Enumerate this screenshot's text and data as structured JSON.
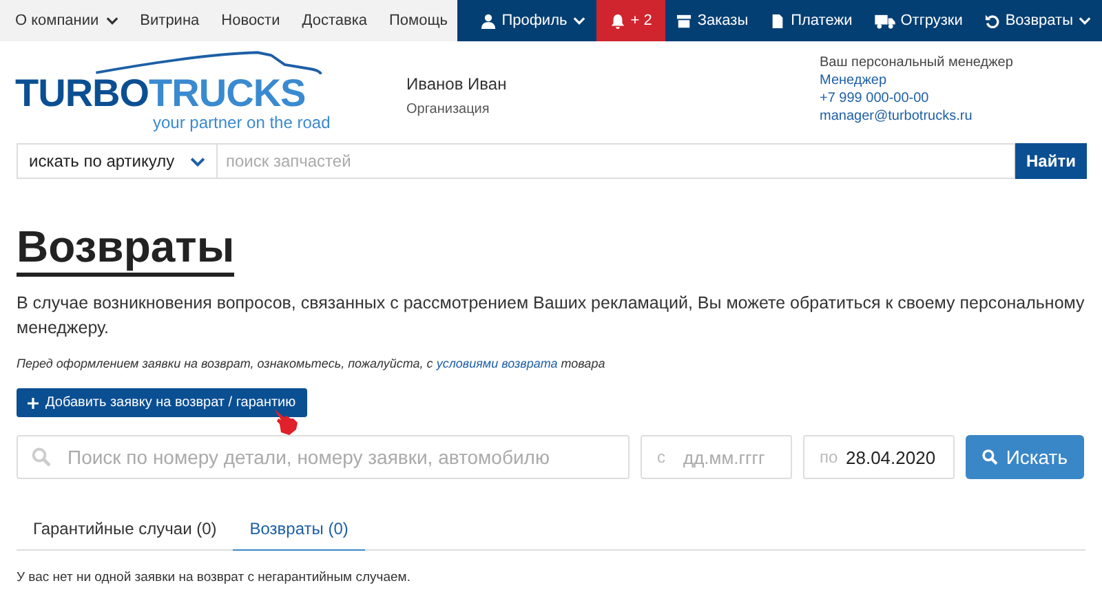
{
  "top_nav": {
    "left": [
      {
        "label": "О компании",
        "dropdown": true
      },
      {
        "label": "Витрина",
        "dropdown": false
      },
      {
        "label": "Новости",
        "dropdown": false
      },
      {
        "label": "Доставка",
        "dropdown": false
      },
      {
        "label": "Помощь",
        "dropdown": false
      }
    ],
    "right": [
      {
        "kind": "profile",
        "label": "Профиль",
        "dropdown": true,
        "highlighted": false
      },
      {
        "kind": "notifications",
        "label": "+ 2",
        "dropdown": false,
        "highlighted": true
      },
      {
        "kind": "orders",
        "label": "Заказы",
        "dropdown": false,
        "highlighted": false
      },
      {
        "kind": "payments",
        "label": "Платежи",
        "dropdown": false,
        "highlighted": false
      },
      {
        "kind": "shipments",
        "label": "Отгрузки",
        "dropdown": false,
        "highlighted": false
      },
      {
        "kind": "returns",
        "label": "Возвраты",
        "dropdown": true,
        "highlighted": false
      }
    ]
  },
  "header": {
    "logo": {
      "part1": "TURBO",
      "part2": "TRUCKS",
      "tagline": "your partner on the road"
    },
    "user": {
      "name": "Иванов Иван",
      "organization": "Организация"
    },
    "manager": {
      "heading": "Ваш персональный менеджер",
      "name": "Менеджер",
      "phone": "+7 999 000-00-00",
      "email": "manager@turbotrucks.ru"
    }
  },
  "part_search": {
    "mode": "искать по артикулу",
    "placeholder": "поиск запчастей",
    "button": "Найти"
  },
  "page": {
    "title": "Возвраты",
    "intro": "В случае возникновения вопросов, связанных с рассмотрением Ваших рекламаций, Вы можете обратиться к своему персональному менеджеру.",
    "note_before": "Перед оформлением заявки на возврат, ознакомьтесь, пожалуйста, с",
    "note_link": "условиями возврата",
    "note_after": "товара",
    "add_button": "Добавить заявку на возврат / гарантию"
  },
  "filter": {
    "search_placeholder": "Поиск по номеру детали, номеру заявки, автомобилю",
    "date_from": {
      "prefix": "с",
      "placeholder": "дд.мм.гггг"
    },
    "date_to": {
      "prefix": "по",
      "value": "28.04.2020"
    },
    "button": "Искать"
  },
  "tabs": [
    {
      "label": "Гарантийные случаи (0)",
      "selected": false
    },
    {
      "label": "Возвраты (0)",
      "selected": true
    }
  ],
  "empty_message": "У вас нет ни одной заявки на возврат с негарантийным случаем."
}
